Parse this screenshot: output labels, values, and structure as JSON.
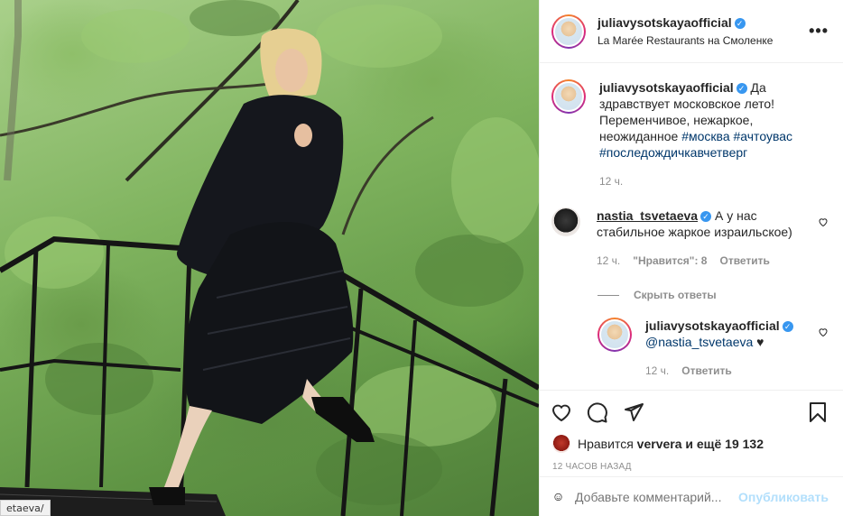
{
  "photo": {
    "url_tooltip": "etaeva/"
  },
  "header": {
    "username": "juliavysotskaya​official",
    "location": "La Marée Restaurants на Смоленке",
    "more_icon": "more-icon"
  },
  "caption": {
    "username": "juliavysotskayaofficial",
    "text": "Да здравствует московское лето! Переменчивое, нежаркое, неожиданное",
    "tags": [
      "#москва",
      "#ачтоувас",
      "#последождичкавчетверг"
    ],
    "time": "12 ч."
  },
  "comment": {
    "username": "nastia_tsvetaeva",
    "text": "А у нас стабильное жаркое израильское)",
    "time": "12 ч.",
    "likes": "\"Нравится\": 8",
    "reply_label": "Ответить",
    "hide_replies": "Скрыть ответы"
  },
  "reply": {
    "username": "juliavysotskayaofficial",
    "mention": "@nastia_tsvetaeva",
    "emoji": "♥",
    "time": "12 ч.",
    "reply_label": "Ответить"
  },
  "likes": {
    "prefix": "Нравится",
    "user": "ververa",
    "suffix": "и ещё 19 132"
  },
  "date": "12 ЧАСОВ НАЗАД",
  "add_comment": {
    "placeholder": "Добавьте комментарий...",
    "publish": "Опубликовать"
  },
  "colors": {
    "link": "#00376b",
    "verified": "#3897f0",
    "muted": "#8e8e8e",
    "publish": "#b2dffc"
  }
}
